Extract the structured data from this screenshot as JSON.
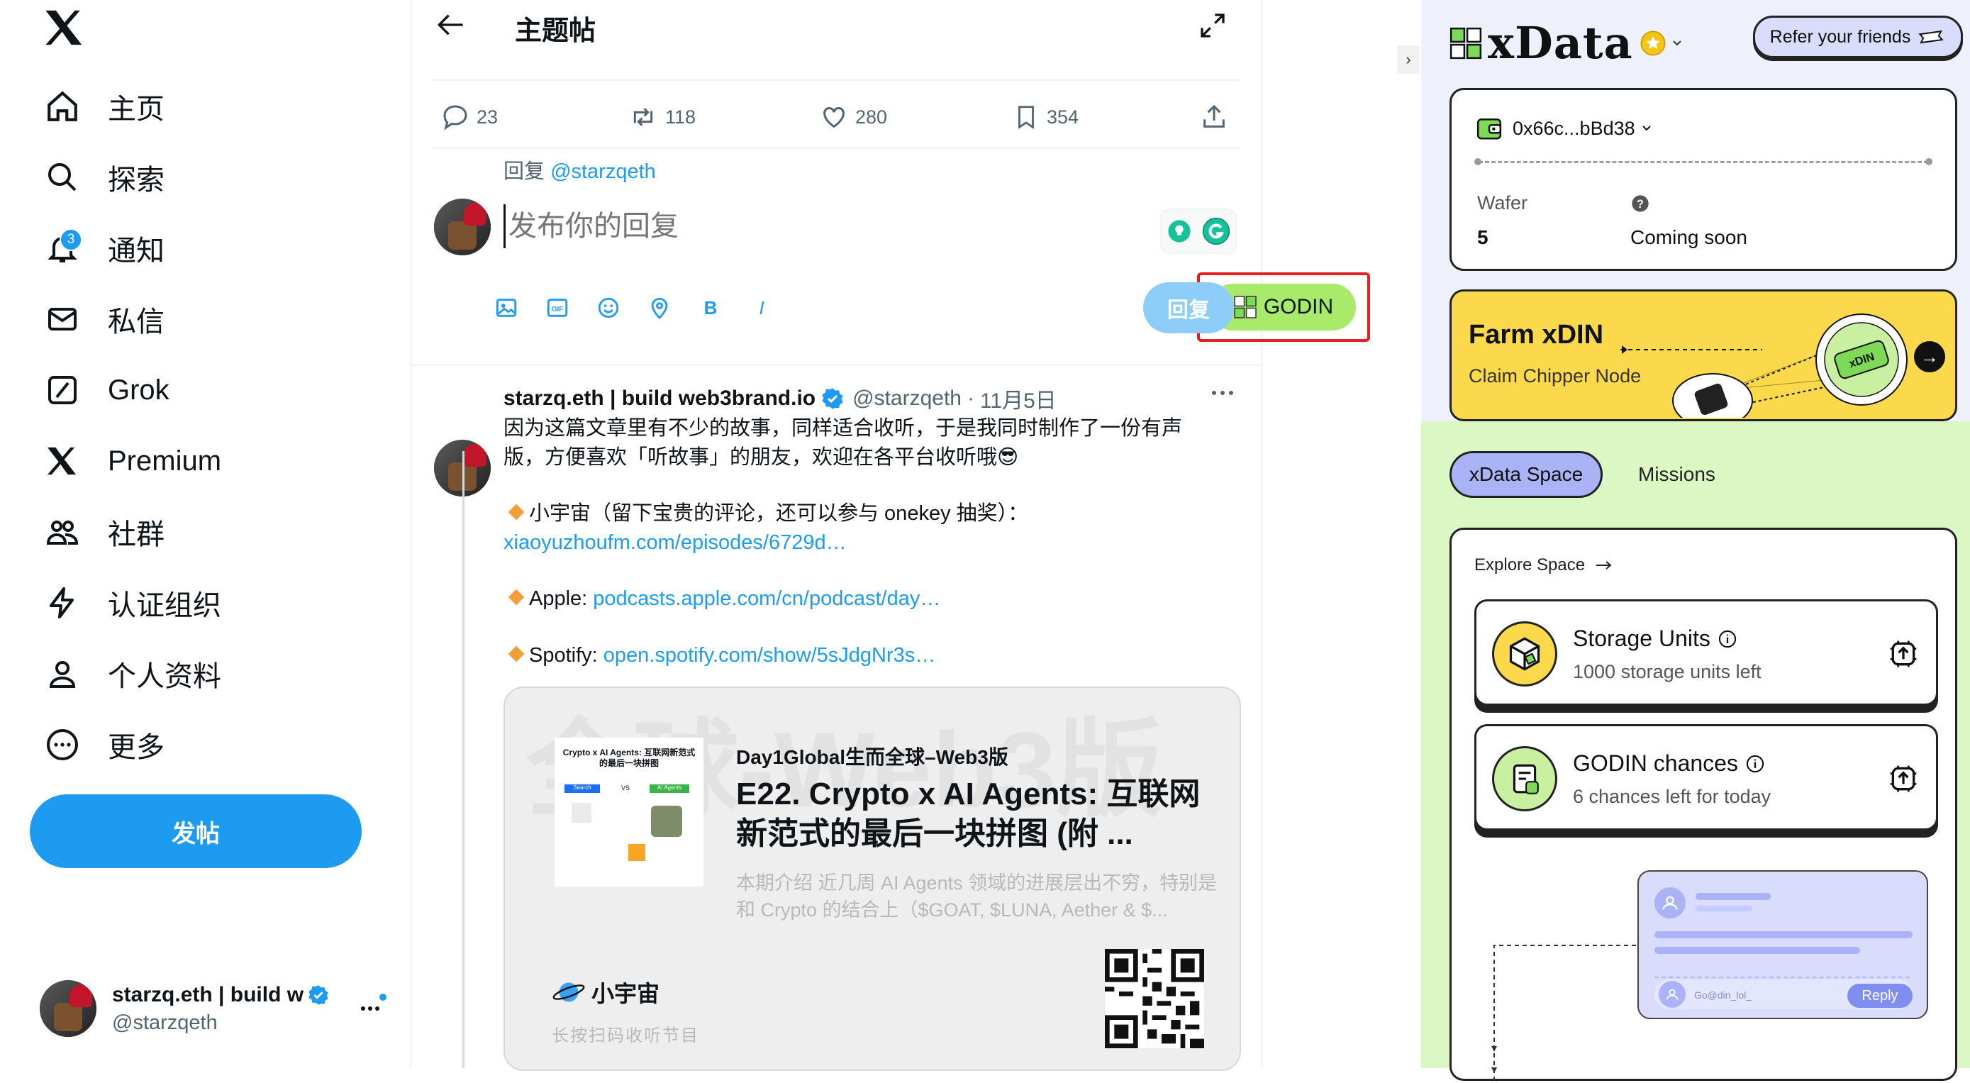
{
  "nav": {
    "items": [
      {
        "label": "主页",
        "icon": "home-icon"
      },
      {
        "label": "探索",
        "icon": "search-icon"
      },
      {
        "label": "通知",
        "icon": "bell-icon",
        "badge": "3"
      },
      {
        "label": "私信",
        "icon": "mail-icon"
      },
      {
        "label": "Grok",
        "icon": "grok-icon"
      },
      {
        "label": "Premium",
        "icon": "x-logo-icon"
      },
      {
        "label": "社群",
        "icon": "communities-icon"
      },
      {
        "label": "认证组织",
        "icon": "lightning-icon"
      },
      {
        "label": "个人资料",
        "icon": "person-icon"
      },
      {
        "label": "更多",
        "icon": "more-circle-icon"
      }
    ],
    "post_label": "发帖",
    "account": {
      "name": "starzq.eth | build w",
      "handle": "@starzqeth"
    }
  },
  "thread": {
    "title": "主题帖",
    "stats": {
      "replies": "23",
      "reposts": "118",
      "likes": "280",
      "bookmarks": "354"
    },
    "reply_to_prefix": "回复 ",
    "reply_to_handle": "@starzqeth",
    "reply_placeholder": "发布你的回复",
    "godin_label": "GODIN",
    "reply_button": "回复",
    "tools": [
      "image-icon",
      "gif-icon",
      "emoji-icon",
      "location-icon",
      "bold-icon",
      "italic-icon"
    ]
  },
  "tweet": {
    "name": "starzq.eth | build web3brand.io",
    "handle": "@starzqeth",
    "dot": "·",
    "date": "11月5日",
    "intro": "因为这篇文章里有不少的故事，同样适合收听，于是我同时制作了一份有声版，方便喜欢「听故事」的朋友，欢迎在各平台收听哦😎",
    "line1_text": "小宇宙（留下宝贵的评论，还可以参与 onekey 抽奖）：",
    "line1_link": "xiaoyuzhoufm.com/episodes/6729d…",
    "line2_text": "Apple: ",
    "line2_link": "podcasts.apple.com/cn/podcast/day…",
    "line3_text": "Spotify: ",
    "line3_link": "open.spotify.com/show/5sJdgNr3s…",
    "card": {
      "bg_text": "全球-Web3版",
      "thumb_title": "Crypto x AI Agents: 互联网新范式的最后一块拼图",
      "thumb_search": "Search",
      "thumb_vs": "VS",
      "thumb_ai": "AI Agents",
      "source": "Day1Global生而全球–Web3版",
      "title": "E22. Crypto x AI Agents: 互联网新范式的最后一块拼图 (附 ...",
      "desc": "本期介绍 近几周 AI Agents 领域的进展层出不穷，特别是和 Crypto 的结合上（$GOAT, $LUNA, Aether & $...",
      "brand": "小宇宙",
      "cta": "长按扫码收听节目"
    }
  },
  "xdata": {
    "logo_text": "xData",
    "refer_label": "Refer your friends",
    "wallet_address": "0x66c...bBd38",
    "wafer_label": "Wafer",
    "wafer_value": "5",
    "coming_soon": "Coming soon",
    "farm_title": "Farm xDIN",
    "farm_sub": "Claim Chipper Node",
    "chip_text": "xDIN",
    "tab_space": "xData Space",
    "tab_missions": "Missions",
    "explore_label": "Explore Space",
    "features": [
      {
        "title": "Storage Units",
        "subtitle": "1000 storage units left"
      },
      {
        "title": "GODIN chances",
        "subtitle": "6 chances left for today"
      }
    ],
    "illus_handle": "Go@din_lol_",
    "illus_reply": "Reply",
    "colors": {
      "accent_green": "#a8ea6a",
      "lavender": "#a9b3f5",
      "yellow": "#fbd94b"
    }
  },
  "panel_toggle": "›"
}
